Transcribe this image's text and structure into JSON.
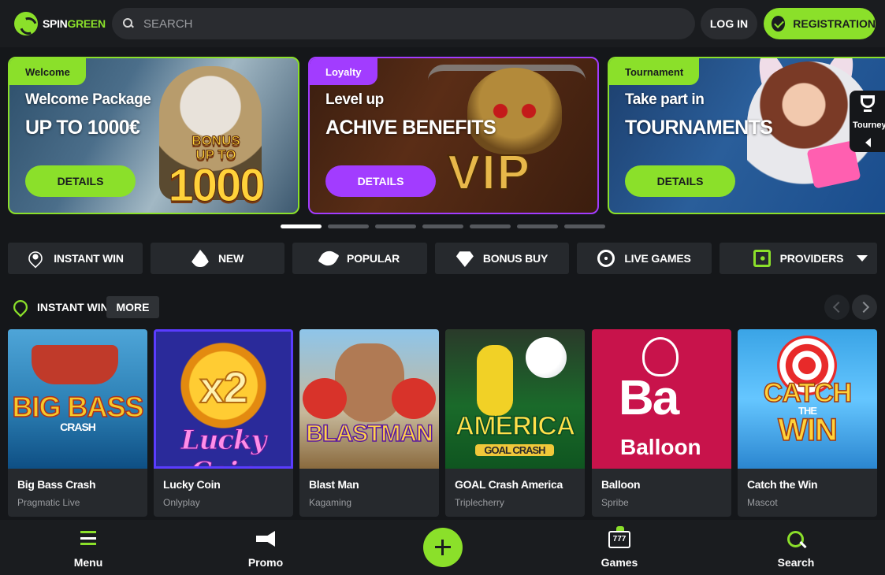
{
  "header": {
    "logo_spin": "SPIN",
    "logo_green": "GREEN",
    "search_placeholder": "SEARCH",
    "login_label": "LOG IN",
    "registration_label": "REGISTRATION"
  },
  "banners": [
    {
      "tag": "Welcome",
      "line1": "Welcome Package",
      "line2": "UP TO 1000€",
      "button": "DETAILS",
      "art_small_1": "BONUS",
      "art_small_2": "UP TO",
      "art_big": "1000"
    },
    {
      "tag": "Loyalty",
      "line1": "Level up",
      "line2": "ACHIVE BENEFITS",
      "button": "DETAILS",
      "art_big": "VIP"
    },
    {
      "tag": "Tournament",
      "line1": "Take part in",
      "line2": "TOURNAMENTS",
      "button": "DETAILS"
    }
  ],
  "tourney_tab": {
    "label": "Tourney"
  },
  "carousel": {
    "pages": 7,
    "active": 1
  },
  "categories": [
    {
      "label": "INSTANT WIN",
      "icon": "rocket-icon"
    },
    {
      "label": "NEW",
      "icon": "fire-icon"
    },
    {
      "label": "POPULAR",
      "icon": "pepper-icon"
    },
    {
      "label": "BONUS BUY",
      "icon": "diamond-icon"
    },
    {
      "label": "LIVE GAMES",
      "icon": "film-reel-icon"
    },
    {
      "label": "PROVIDERS",
      "icon": "play-screen-icon"
    }
  ],
  "section": {
    "title": "INSTANT WIN",
    "more_label": "MORE"
  },
  "games": [
    {
      "name": "Big Bass Crash",
      "provider": "Pragmatic Live",
      "art_1": "BIG BASS",
      "art_2": "CRASH"
    },
    {
      "name": "Lucky Coin",
      "provider": "Onlyplay",
      "art_1": "x2",
      "art_2": "Lucky Coin"
    },
    {
      "name": "Blast Man",
      "provider": "Kagaming",
      "art_1": "BLASTMAN"
    },
    {
      "name": "GOAL Crash America",
      "provider": "Triplecherry",
      "art_1": "AMERICA",
      "art_2": "GOAL CRASH"
    },
    {
      "name": "Balloon",
      "provider": "Spribe",
      "art_1": "Ba",
      "art_2": "Balloon"
    },
    {
      "name": "Catch the Win",
      "provider": "Mascot",
      "art_1": "CATCH",
      "art_2": "THE",
      "art_3": "WIN"
    }
  ],
  "bottom_nav": {
    "menu": "Menu",
    "promo": "Promo",
    "games": "Games",
    "games_icon_text": "777",
    "search": "Search"
  },
  "colors": {
    "accent": "#8be02a",
    "purple": "#a23cff",
    "background": "#15171a",
    "card": "#26292d"
  }
}
